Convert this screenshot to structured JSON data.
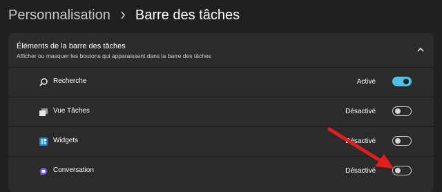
{
  "breadcrumb": {
    "parent": "Personnalisation",
    "current": "Barre des tâches"
  },
  "section": {
    "title": "Éléments de la barre des tâches",
    "description": "Afficher ou masquer les boutons qui apparaissent dans la barre des tâches",
    "expanded": true
  },
  "items": [
    {
      "label": "Recherche",
      "status": "Activé",
      "on": true,
      "icon": "search-icon"
    },
    {
      "label": "Vue Tâches",
      "status": "Désactivé",
      "on": false,
      "icon": "task-view-icon"
    },
    {
      "label": "Widgets",
      "status": "Désactivé",
      "on": false,
      "icon": "widgets-icon"
    },
    {
      "label": "Conversation",
      "status": "Désactivé",
      "on": false,
      "icon": "chat-icon"
    }
  ],
  "colors": {
    "accent": "#4cc2e6",
    "annotation_arrow": "#e11d1d",
    "background": "#202020",
    "panel": "#2b2b2b"
  }
}
